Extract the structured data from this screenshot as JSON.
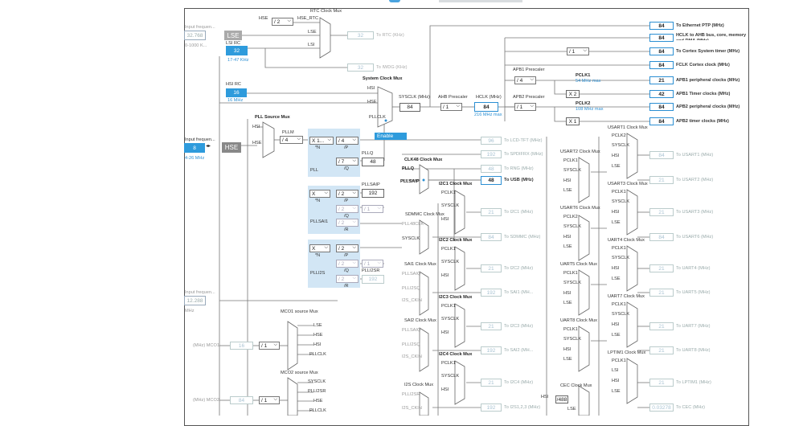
{
  "top_tabs": {
    "active_indicator": "",
    "strip": ""
  },
  "oscillators": {
    "lse": {
      "label": "LSE",
      "input_value": "32.768",
      "range": "0-1000 K..."
    },
    "lsi_rc": {
      "label": "LSI RC",
      "value": "32",
      "range": "17-47 KHz"
    },
    "hsi_rc": {
      "label": "HSI RC",
      "value": "16",
      "freq": "16 MHz"
    },
    "hse": {
      "label": "HSE",
      "input_label": "Input frequen...",
      "input_value": "8",
      "range": "4-26 MHz"
    },
    "i2s": {
      "input_label": "Input frequen...",
      "input_value": "12.288",
      "unit": "MHz"
    }
  },
  "rtc": {
    "title": "RTC Clock Mux",
    "hse_label": "HSE",
    "hse_div": "/ 2",
    "hse_rtc": "HSE_RTC",
    "lse": "LSE",
    "lsi": "LSI",
    "value": "32",
    "output": "To RTC (KHz)"
  },
  "iwdg": {
    "value": "32",
    "output": "To IWDG (KHz)"
  },
  "system_mux": {
    "title": "System Clock Mux",
    "hsi": "HSI",
    "hse": "HSE",
    "pllclk": "PLLCLK",
    "enable": "Enable"
  },
  "pll_source": {
    "title": "PLL Source Mux",
    "hsi": "HSI",
    "hse": "HSE"
  },
  "pll": {
    "pllm_label": "PLLM",
    "pllm": "/ 4",
    "plln": "X 1...",
    "n": "*N",
    "pllp": "/ 4",
    "p": "/P",
    "pllq": "/ 7",
    "q": "/Q",
    "pllq_label": "PLLQ",
    "pllq_value": "48",
    "name": "PLL"
  },
  "pllsai": {
    "n": "X",
    "nlabel": "*N",
    "p": "/ 2",
    "plabel": "/P",
    "q": "/ 2",
    "qlabel": "/Q",
    "q2": "/ 1",
    "r": "/ 2",
    "rlabel": "/R",
    "pllsaip_label": "PLLSAIP",
    "pllsaip_value": "192",
    "name": "PLLSAI1"
  },
  "plli2s": {
    "n": "X",
    "nlabel": "*N",
    "p": "/ 2",
    "plabel": "/P",
    "q": "/ 2",
    "qlabel": "/Q",
    "q2": "/ 1",
    "r": "/ 2",
    "rlabel": "/R",
    "plli2sr_label": "PLLI2SR",
    "plli2sr_value": "192",
    "name": "PLLI2S"
  },
  "sysclk": {
    "label": "SYSCLK (MHz)",
    "value": "84"
  },
  "ahb": {
    "label": "AHB Prescaler",
    "value": "/ 1"
  },
  "hclk": {
    "label": "HCLK (MHz)",
    "value": "84",
    "max": "216 MHz max"
  },
  "apb1": {
    "label": "APB1 Prescaler",
    "value": "/ 4",
    "pclk": "PCLK1",
    "pclk_max": "54 MHz max",
    "timer_mult": "X 2"
  },
  "apb2": {
    "label": "APB2 Prescaler",
    "value": "/ 1",
    "pclk": "PCLK2",
    "pclk_max": "108 MHz max",
    "timer_mult": "X 1"
  },
  "cortex_div": "/ 1",
  "outputs": [
    {
      "value": "84",
      "label": "To Ethernet PTP (MHz)"
    },
    {
      "value": "84",
      "label": "HCLK to AHB bus, core, memory and DMA (MHz)"
    },
    {
      "value": "84",
      "label": "To Cortex System timer (MHz)"
    },
    {
      "value": "84",
      "label": "FCLK Cortex clock (MHz)"
    },
    {
      "value": "21",
      "label": "APB1 peripheral clocks (MHz)"
    },
    {
      "value": "42",
      "label": "APB1 Timer clocks (MHz)"
    },
    {
      "value": "84",
      "label": "APB2 peripheral clocks (MHz)"
    },
    {
      "value": "84",
      "label": "APB2 timer clocks (MHz)"
    }
  ],
  "mid_outputs": [
    {
      "value": "96",
      "label": "To LCD-TFT (MHz)"
    },
    {
      "value": "192",
      "label": "To SPDIFRX (MHz)"
    },
    {
      "value": "48",
      "label": "To RNG (MHz)"
    },
    {
      "value": "48",
      "label": "To USB (MHz)"
    }
  ],
  "clk48": {
    "title": "CLK48 Clock Mux",
    "pllq": "PLLQ",
    "pllsaip": "PLLSAIP"
  },
  "i2c_muxes": [
    {
      "title": "I2C1 Clock Mux",
      "inputs": [
        "PCLK1",
        "SYSCLK",
        "HSI"
      ],
      "value": "21",
      "label": "To I2C1 (MHz)"
    },
    {
      "title": "I2C2 Clock Mux",
      "inputs": [
        "PCLK1",
        "SYSCLK",
        "HSI"
      ],
      "value": "21",
      "label": "To I2C2 (MHz)"
    },
    {
      "title": "I2C3 Clock Mux",
      "inputs": [
        "PCLK1",
        "SYSCLK",
        "HSI"
      ],
      "value": "21",
      "label": "To I2C3 (MHz)"
    },
    {
      "title": "I2C4 Clock Mux",
      "inputs": [
        "PCLK1",
        "SYSCLK",
        "HSI"
      ],
      "value": "21",
      "label": "To I2C4 (MHz)"
    }
  ],
  "sdmmc": {
    "title": "SDMMC Clock Mux",
    "inputs": [
      "PLL48CLK",
      "SYSCLK"
    ],
    "value": "84",
    "label": "To SDMMC (MHz)"
  },
  "sai1": {
    "title": "SAI1 Clock Mux",
    "inputs": [
      "PLLSAIQ",
      "PLLI2SQ",
      "I2S_CKIN"
    ],
    "value": "192",
    "label": "To SAI1 (MH..."
  },
  "sai2": {
    "title": "SAI2 Clock Mux",
    "inputs": [
      "PLLSAIQ",
      "PLLI2SQ",
      "I2S_CKIN"
    ],
    "value": "192",
    "label": "To SAI2 (MH..."
  },
  "i2s": {
    "title": "I2S Clock Mux",
    "inputs": [
      "PLLI2SR",
      "I2S_CKIN"
    ],
    "value": "192",
    "label": "To I2S1,2,3 (MHz)"
  },
  "uart_muxes": [
    {
      "title": "USART1 Clock Mux",
      "inputs": [
        "PCLK2",
        "SYSCLK",
        "HSI",
        "LSE"
      ],
      "value": "84",
      "label": "To USART1 (MHz)"
    },
    {
      "title": "USART2 Clock Mux",
      "inputs": [
        "PCLK1",
        "SYSCLK",
        "HSI",
        "LSE"
      ],
      "value": "21",
      "label": "To USART2 (MHz)"
    },
    {
      "title": "USART3 Clock Mux",
      "inputs": [
        "PCLK1",
        "SYSCLK",
        "HSI",
        "LSE"
      ],
      "value": "21",
      "label": "To USART3 (MHz)"
    },
    {
      "title": "USART6 Clock Mux",
      "inputs": [
        "PCLK2",
        "SYSCLK",
        "HSI",
        "LSE"
      ],
      "value": "84",
      "label": "To USART6 (MHz)"
    },
    {
      "title": "UART4 Clock Mux",
      "inputs": [
        "PCLK1",
        "SYSCLK",
        "HSI",
        "LSE"
      ],
      "value": "21",
      "label": "To UART4 (MHz)"
    },
    {
      "title": "UART5 Clock Mux",
      "inputs": [
        "PCLK1",
        "SYSCLK",
        "HSI",
        "LSE"
      ],
      "value": "21",
      "label": "To UART5 (MHz)"
    },
    {
      "title": "UART7 Clock Mux",
      "inputs": [
        "PCLK1",
        "SYSCLK",
        "HSI",
        "LSE"
      ],
      "value": "21",
      "label": "To UART7 (MHz)"
    },
    {
      "title": "UART8 Clock Mux",
      "inputs": [
        "PCLK1",
        "SYSCLK",
        "HSI",
        "LSE"
      ],
      "value": "21",
      "label": "To UART8 (MHz)"
    },
    {
      "title": "LPTIM1 Clock Mux",
      "inputs": [
        "PCLK1",
        "LSI",
        "HSI",
        "LSE"
      ],
      "value": "21",
      "label": "To LPTIM1 (MHz)"
    }
  ],
  "cec": {
    "title": "CEC Clock Mux",
    "hsi": "HSI",
    "div": "/488",
    "lse": "LSE",
    "value": "0.03278",
    "label": "To CEC (MHz)"
  },
  "mco1": {
    "title": "MCO1 source Mux",
    "inputs": [
      "LSE",
      "HSE",
      "HSI",
      "PLLCLK"
    ],
    "div": "/ 1",
    "value": "16",
    "label": "(MHz) MCO1"
  },
  "mco2": {
    "title": "MCO2 source Mux",
    "inputs": [
      "SYSCLK",
      "PLLI2SR",
      "HSE",
      "PLLCLK"
    ],
    "div": "/ 1",
    "value": "84",
    "label": "(MHz) MCO2"
  }
}
